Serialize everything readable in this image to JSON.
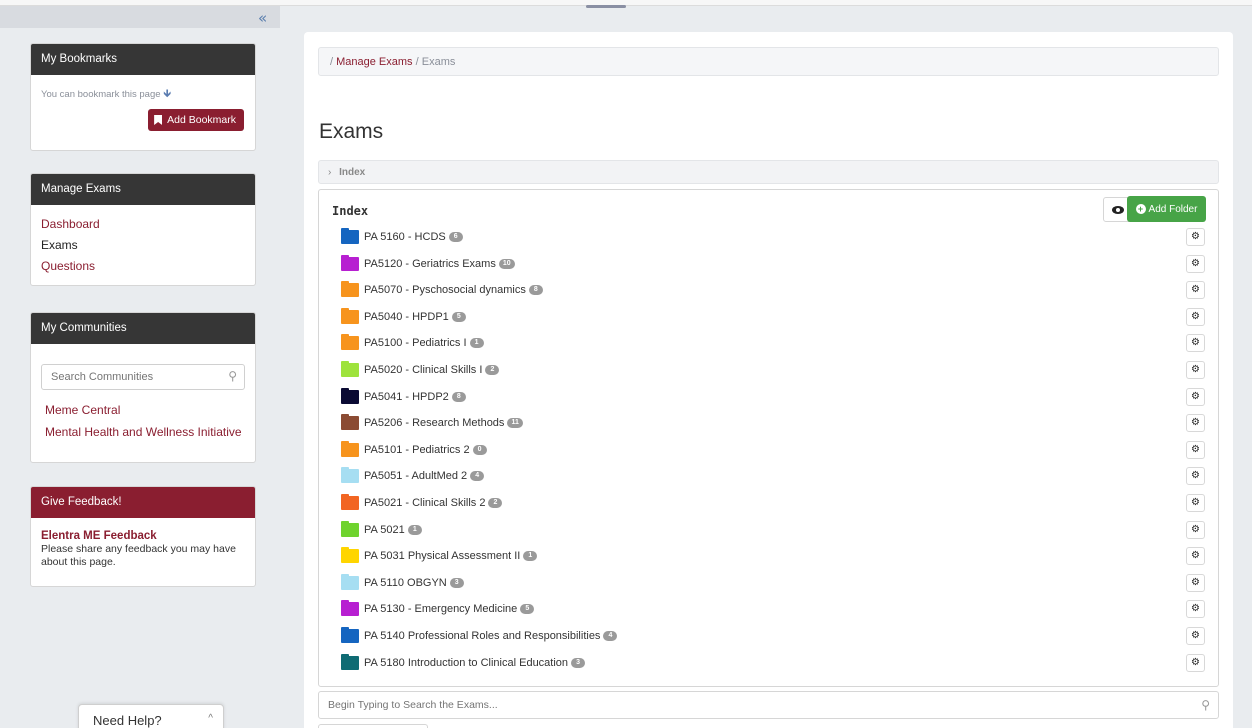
{
  "sidebar": {
    "collapse_glyph": "«",
    "bookmarks": {
      "title": "My Bookmarks",
      "note": "You can bookmark this page",
      "note_arrow": "🡻",
      "button_label": "Add Bookmark"
    },
    "manage_exams": {
      "title": "Manage Exams",
      "items": [
        {
          "label": "Dashboard",
          "active": false
        },
        {
          "label": "Exams",
          "active": true
        },
        {
          "label": "Questions",
          "active": false
        }
      ]
    },
    "communities": {
      "title": "My Communities",
      "search_placeholder": "Search Communities",
      "items": [
        {
          "label": "Meme Central"
        },
        {
          "label": "Mental Health and Wellness Initiative"
        }
      ]
    },
    "feedback": {
      "title": "Give Feedback!",
      "heading": "Elentra ME Feedback",
      "text": "Please share any feedback you may have about this page."
    }
  },
  "help_tab": {
    "label": "Need Help?",
    "chevron": "^"
  },
  "main": {
    "breadcrumb": {
      "sep": "/",
      "link": "Manage Exams",
      "current": "Exams"
    },
    "page_title": "Exams",
    "index_toggle": {
      "caret": "›",
      "label": "Index"
    },
    "index_panel": {
      "title": "Index",
      "add_folder_label": "Add Folder",
      "folders": [
        {
          "name": "PA 5160 - HCDS",
          "count": "6",
          "color": "#1565c0"
        },
        {
          "name": "PA5120 - Geriatrics Exams",
          "count": "10",
          "color": "#b71fd1"
        },
        {
          "name": "PA5070 - Pyschosocial dynamics",
          "count": "8",
          "color": "#f7941d"
        },
        {
          "name": "PA5040 - HPDP1",
          "count": "5",
          "color": "#f7941d"
        },
        {
          "name": "PA5100 - Pediatrics I",
          "count": "1",
          "color": "#f7941d"
        },
        {
          "name": "PA5020 - Clinical Skills I",
          "count": "2",
          "color": "#9ee33c"
        },
        {
          "name": "PA5041 - HPDP2",
          "count": "8",
          "color": "#0a0a33"
        },
        {
          "name": "PA5206 - Research Methods",
          "count": "11",
          "color": "#8b4b33"
        },
        {
          "name": "PA5101 - Pediatrics 2",
          "count": "0",
          "color": "#f7941d"
        },
        {
          "name": "PA5051 - AdultMed 2",
          "count": "4",
          "color": "#a6def2"
        },
        {
          "name": "PA5021 - Clinical Skills 2",
          "count": "2",
          "color": "#f26522"
        },
        {
          "name": "PA 5021",
          "count": "1",
          "color": "#6fd32e"
        },
        {
          "name": "PA 5031 Physical Assessment II",
          "count": "1",
          "color": "#ffd500"
        },
        {
          "name": "PA 5110 OBGYN",
          "count": "3",
          "color": "#a6def2"
        },
        {
          "name": "PA 5130 - Emergency Medicine",
          "count": "5",
          "color": "#b71fd1"
        },
        {
          "name": "PA 5140 Professional Roles and Responsibilities",
          "count": "4",
          "color": "#1565c0"
        },
        {
          "name": "PA 5180 Introduction to Clinical Education",
          "count": "3",
          "color": "#0f6b73"
        }
      ]
    },
    "exam_search_placeholder": "Begin Typing to Search the Exams..."
  },
  "colors": {
    "brand": "#8a1e30",
    "dark_header": "#363636",
    "success": "#47a447"
  }
}
